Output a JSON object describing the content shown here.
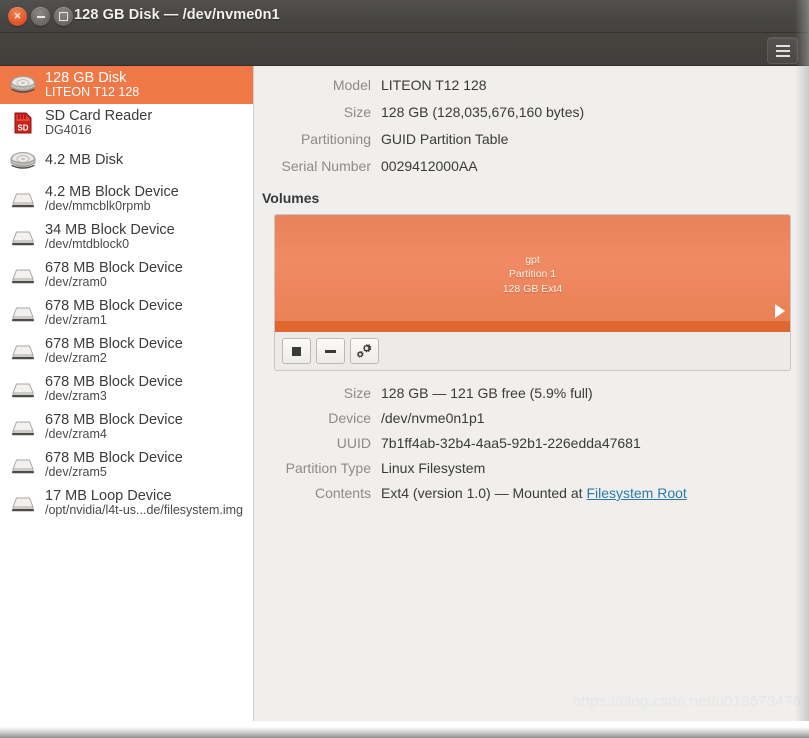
{
  "window": {
    "title": "128 GB Disk — /dev/nvme0n1",
    "controls": {
      "close": "close-button",
      "minimize": "minimize-button",
      "maximize": "maximize-button"
    },
    "menu_button": "menu-button"
  },
  "sidebar": {
    "items": [
      {
        "title": "128 GB Disk",
        "sub": "LITEON T12 128",
        "icon": "hard-disk-icon",
        "selected": true
      },
      {
        "title": "SD Card Reader",
        "sub": "DG4016",
        "icon": "sd-card-icon",
        "selected": false
      },
      {
        "title": "4.2 MB Disk",
        "sub": "",
        "icon": "hard-disk-icon",
        "selected": false
      },
      {
        "title": "4.2 MB Block Device",
        "sub": "/dev/mmcblk0rpmb",
        "icon": "block-device-icon",
        "selected": false
      },
      {
        "title": "34 MB Block Device",
        "sub": "/dev/mtdblock0",
        "icon": "block-device-icon",
        "selected": false
      },
      {
        "title": "678 MB Block Device",
        "sub": "/dev/zram0",
        "icon": "block-device-icon",
        "selected": false
      },
      {
        "title": "678 MB Block Device",
        "sub": "/dev/zram1",
        "icon": "block-device-icon",
        "selected": false
      },
      {
        "title": "678 MB Block Device",
        "sub": "/dev/zram2",
        "icon": "block-device-icon",
        "selected": false
      },
      {
        "title": "678 MB Block Device",
        "sub": "/dev/zram3",
        "icon": "block-device-icon",
        "selected": false
      },
      {
        "title": "678 MB Block Device",
        "sub": "/dev/zram4",
        "icon": "block-device-icon",
        "selected": false
      },
      {
        "title": "678 MB Block Device",
        "sub": "/dev/zram5",
        "icon": "block-device-icon",
        "selected": false
      },
      {
        "title": "17 MB Loop Device",
        "sub": "/opt/nvidia/l4t-us...de/filesystem.img",
        "icon": "block-device-icon",
        "selected": false
      }
    ]
  },
  "drive": {
    "model_label": "Model",
    "model_value": "LITEON T12 128",
    "size_label": "Size",
    "size_value": "128 GB (128,035,676,160 bytes)",
    "partitioning_label": "Partitioning",
    "partitioning_value": "GUID Partition Table",
    "serial_label": "Serial Number",
    "serial_value": "0029412000AA"
  },
  "volumes": {
    "heading": "Volumes",
    "block": {
      "line1": "gpt",
      "line2": "Partition 1",
      "line3": "128 GB Ext4",
      "fill_color": "#ef8a63",
      "usage_color": "#e0662f",
      "arrow": "play-triangle-icon"
    },
    "toolbar": {
      "unmount": "stop-square-icon",
      "delete": "minus-icon",
      "more": "gears-icon"
    }
  },
  "partition": {
    "size_label": "Size",
    "size_value": "128 GB — 121 GB free (5.9% full)",
    "device_label": "Device",
    "device_value": "/dev/nvme0n1p1",
    "uuid_label": "UUID",
    "uuid_value": "7b1ff4ab-32b4-4aa5-92b1-226edda47681",
    "partition_type_label": "Partition Type",
    "partition_type_value": "Linux Filesystem",
    "contents_label": "Contents",
    "contents_value_prefix": "Ext4 (version 1.0) — Mounted at ",
    "contents_link": "Filesystem Root"
  },
  "watermark": "https://blog.csdn.net/u013673476"
}
